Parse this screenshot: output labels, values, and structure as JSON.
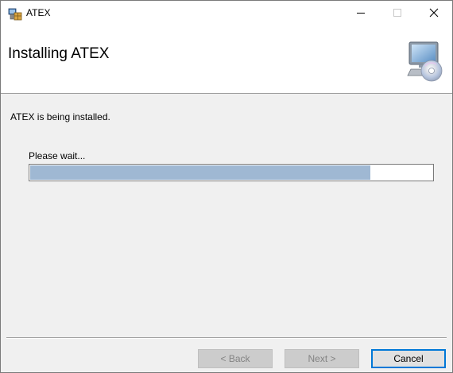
{
  "window": {
    "title": "ATEX",
    "controls": {
      "minimize": "minimize",
      "maximize": "maximize",
      "close": "close"
    }
  },
  "banner": {
    "title": "Installing ATEX",
    "icon": "computer-cd-icon"
  },
  "body": {
    "status": "ATEX is being installed.",
    "wait": "Please wait...",
    "progress_percent": 84.5
  },
  "buttons": {
    "back": "< Back",
    "next": "Next >",
    "cancel": "Cancel"
  },
  "colors": {
    "progress_fill": "#9fb8d3",
    "focus_border": "#0078d7"
  }
}
